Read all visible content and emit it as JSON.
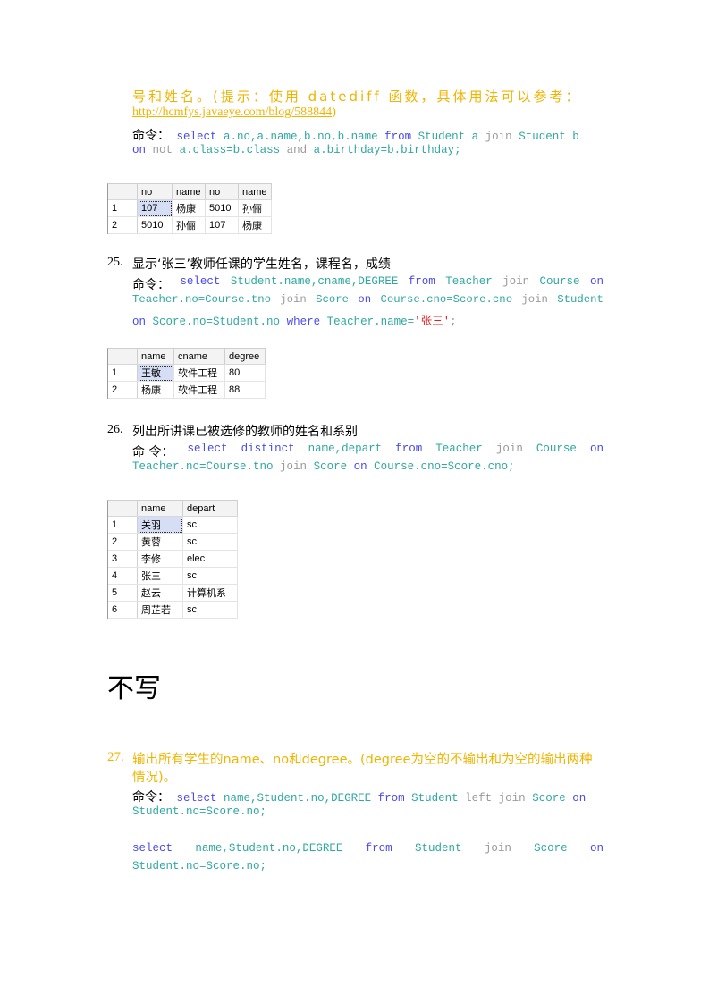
{
  "q24": {
    "line1": "号和姓名。(提示：使用 datediff 函数，具体用法可以参考：",
    "link": "http://hcmfys.javaeye.com/blog/588844",
    "link_close": ")",
    "cmd_label": "命令：",
    "code1": [
      "select",
      "a.no,a.name,b.no,b.name",
      "from",
      "Student a",
      "join",
      "Student b"
    ],
    "code2": [
      "on",
      "not",
      "a.class=b.class",
      "and",
      "a.birthday=b.birthday;"
    ],
    "table": {
      "headers": [
        "",
        "no",
        "name",
        "no",
        "name"
      ],
      "rows": [
        [
          "1",
          "107",
          "杨康",
          "5010",
          "孙俪"
        ],
        [
          "2",
          "5010",
          "孙俪",
          "107",
          "杨康"
        ]
      ]
    }
  },
  "q25": {
    "number": "25.",
    "title": "显示‘张三’教师任课的学生姓名，课程名，成绩",
    "cmd_label": "命令：",
    "code1": [
      "select",
      "Student.name,cname,DEGREE",
      "from",
      "Teacher",
      "join",
      "Course",
      "on"
    ],
    "code2": [
      "Teacher.no=Course.tno",
      "join",
      "Score",
      "on",
      "Course.cno=Score.cno",
      "join",
      "Student"
    ],
    "code3": [
      "on",
      "Score.no=Student.no",
      "where",
      "Teacher.name=",
      "'张三'",
      ";"
    ],
    "table": {
      "headers": [
        "",
        "name",
        "cname",
        "degree"
      ],
      "rows": [
        [
          "1",
          "王敏",
          "软件工程",
          "80"
        ],
        [
          "2",
          "杨康",
          "软件工程",
          "88"
        ]
      ]
    }
  },
  "q26": {
    "number": "26.",
    "title": "列出所讲课已被选修的教师的姓名和系别",
    "cmd_label": "命 令：",
    "code1": [
      "select",
      "distinct",
      "name,depart",
      "from",
      "Teacher",
      "join",
      "Course",
      "on"
    ],
    "code2": [
      "Teacher.no=Course.tno",
      "join",
      "Score",
      "on",
      "Course.cno=Score.cno;"
    ],
    "table": {
      "headers": [
        "",
        "name",
        "depart"
      ],
      "rows": [
        [
          "1",
          "关羽",
          "sc"
        ],
        [
          "2",
          "黄蓉",
          "sc"
        ],
        [
          "3",
          "李修",
          "elec"
        ],
        [
          "4",
          "张三",
          "sc"
        ],
        [
          "5",
          "赵云",
          "计算机系"
        ],
        [
          "6",
          "周芷若",
          "sc"
        ]
      ]
    }
  },
  "big_heading": "不写",
  "q27": {
    "number": "27.",
    "title1": "输出所有学生的name、no和degree。(degree为空的不输出和为空的输出两种",
    "title2": "情况)。",
    "cmd_label": "命令：",
    "code1": [
      "select",
      "name,Student.no,DEGREE",
      "from",
      "Student",
      "left join",
      "Score",
      "on"
    ],
    "code2": [
      "Student.no=Score.no;"
    ],
    "code3": [
      "select",
      "name,Student.no,DEGREE",
      "from",
      "Student",
      "join",
      "Score",
      "on"
    ],
    "code4": [
      "Student.no=Score.no;"
    ]
  }
}
